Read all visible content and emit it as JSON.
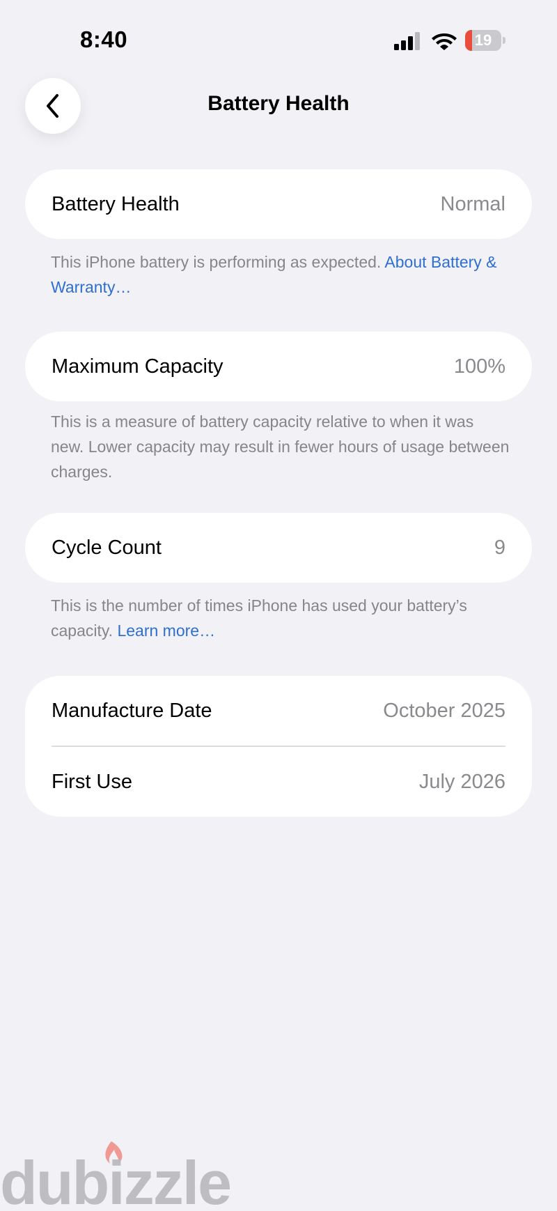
{
  "status_bar": {
    "time": "8:40",
    "battery_level": "19",
    "battery_fraction": 0.19,
    "battery_color": "#eb4d3d"
  },
  "nav": {
    "back_icon": "chevron-left-icon",
    "title": "Battery Health"
  },
  "battery_health": {
    "label": "Battery Health",
    "value": "Normal",
    "note": "This iPhone battery is performing as expected.",
    "link": "About Battery & Warranty…"
  },
  "maximum_capacity": {
    "label": "Maximum Capacity",
    "value": "100%",
    "note": "This is a measure of battery capacity relative to when it was new. Lower capacity may result in fewer hours of usage between charges."
  },
  "cycle_count": {
    "label": "Cycle Count",
    "value": "9",
    "note": "This is the number of times iPhone has used your battery’s capacity.",
    "link": "Learn more…"
  },
  "dates": {
    "manufacture_label": "Manufacture Date",
    "manufacture_value": "October 2025",
    "first_use_label": "First Use",
    "first_use_value": "July 2026"
  },
  "watermark": {
    "text": "dubizzle"
  },
  "colors": {
    "background": "#f1f1f6",
    "link": "#2f6fd1",
    "secondary_text": "#85858a"
  }
}
